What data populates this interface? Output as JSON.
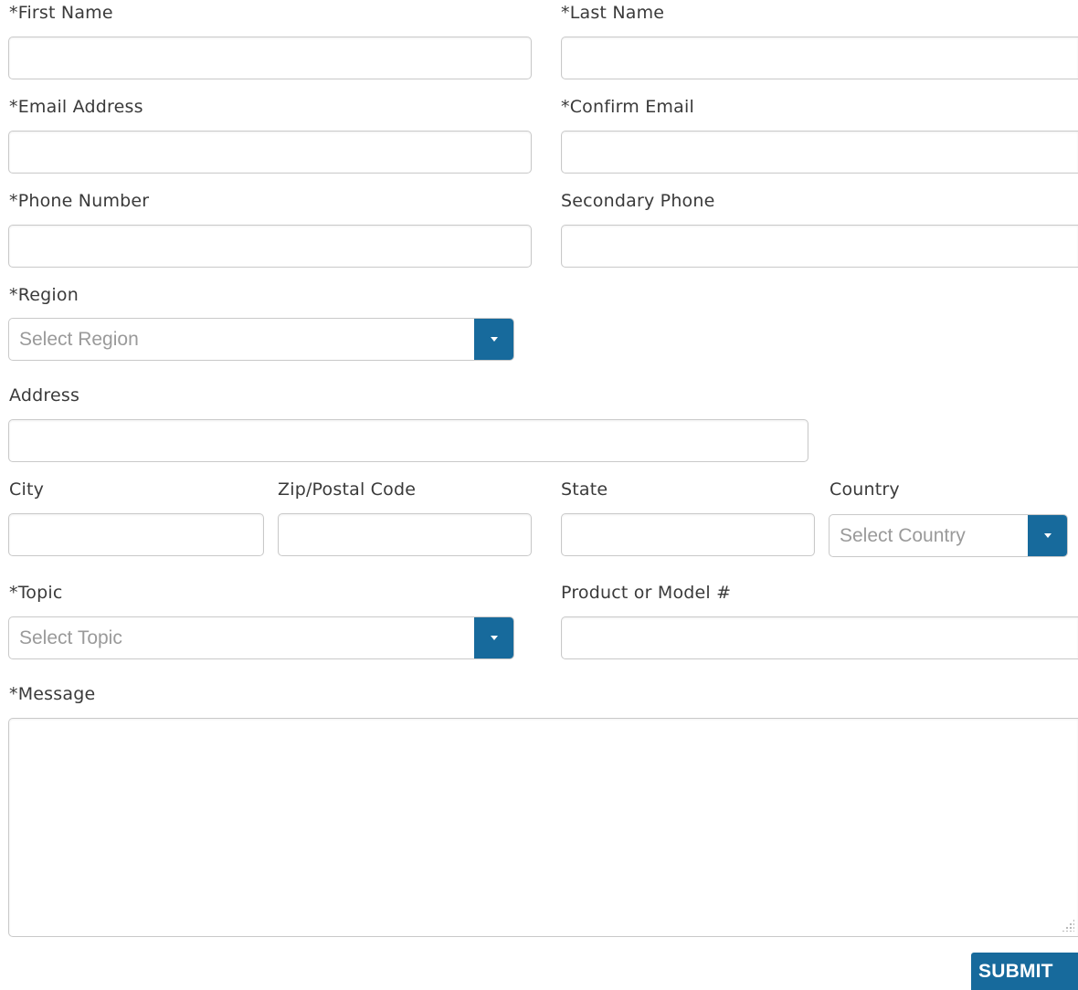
{
  "form": {
    "first_name": {
      "label": "*First Name",
      "value": "",
      "placeholder": ""
    },
    "last_name": {
      "label": "*Last Name",
      "value": "",
      "placeholder": ""
    },
    "email": {
      "label": "*Email Address",
      "value": "",
      "placeholder": ""
    },
    "confirm_email": {
      "label": "*Confirm Email",
      "value": "",
      "placeholder": ""
    },
    "phone": {
      "label": "*Phone Number",
      "value": "",
      "placeholder": ""
    },
    "secondary_phone": {
      "label": "Secondary Phone",
      "value": "",
      "placeholder": ""
    },
    "region": {
      "label": "*Region",
      "selected": "Select Region"
    },
    "address": {
      "label": "Address",
      "value": "",
      "placeholder": ""
    },
    "city": {
      "label": "City",
      "value": "",
      "placeholder": ""
    },
    "zip": {
      "label": "Zip/Postal Code",
      "value": "",
      "placeholder": ""
    },
    "state": {
      "label": "State",
      "value": "",
      "placeholder": ""
    },
    "country": {
      "label": "Country",
      "selected": "Select Country"
    },
    "topic": {
      "label": "*Topic",
      "selected": "Select Topic"
    },
    "product": {
      "label": "Product or Model #",
      "value": "",
      "placeholder": ""
    },
    "message": {
      "label": "*Message",
      "value": "",
      "placeholder": ""
    },
    "submit_label": "SUBMIT"
  },
  "icons": {
    "dropdown": "caret-down-icon",
    "resize": "resize-grip-icon"
  },
  "colors": {
    "accent": "#176a9c",
    "border": "#c9c9c9",
    "label": "#3a3a3a",
    "placeholder": "#9a9a9a"
  }
}
